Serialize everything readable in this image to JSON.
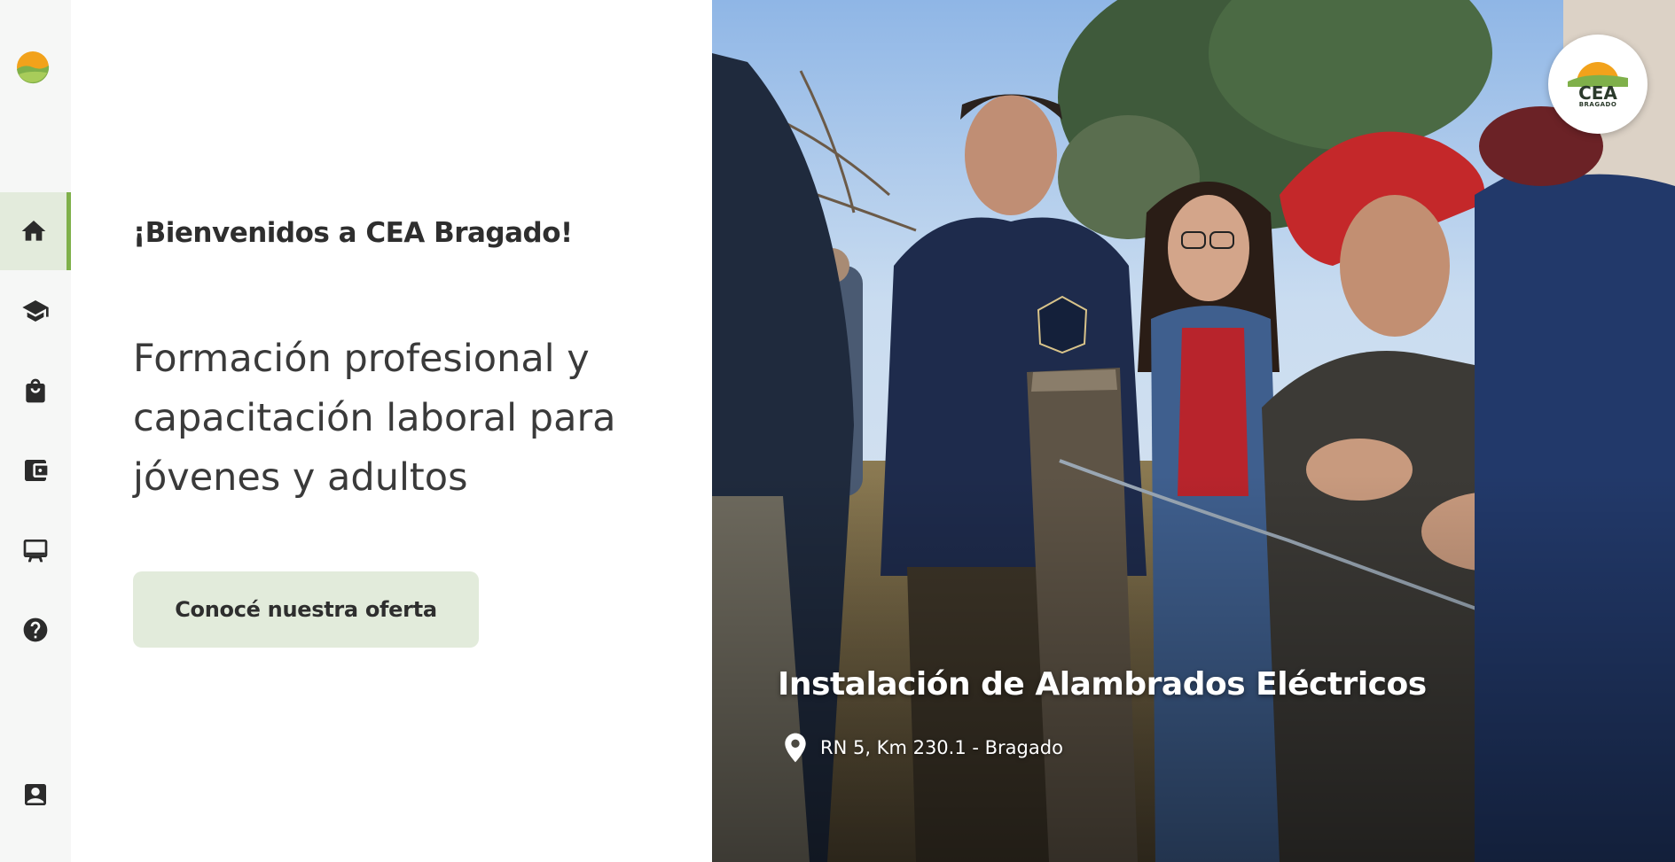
{
  "brand": {
    "badge_text": "CEA",
    "badge_subtext": "BRAGADO",
    "colors": {
      "sun": "#f2a21b",
      "field": "#7fb04a",
      "accent": "#7fb04a",
      "button_bg": "#e2ebdb"
    }
  },
  "sidebar": {
    "items": [
      {
        "icon": "home-icon",
        "active": true
      },
      {
        "icon": "graduation-cap-icon",
        "active": false
      },
      {
        "icon": "shopping-bag-icon",
        "active": false
      },
      {
        "icon": "wallet-icon",
        "active": false
      },
      {
        "icon": "presentation-board-icon",
        "active": false
      },
      {
        "icon": "help-icon",
        "active": false
      },
      {
        "icon": "contact-card-icon",
        "active": false
      }
    ]
  },
  "main": {
    "welcome": "¡Bienvenidos a CEA Bragado!",
    "headline": "Formación profesional y capacitación laboral para jóvenes y adultos",
    "cta_label": "Conocé nuestra oferta"
  },
  "hero": {
    "title": "Instalación de Alambrados Eléctricos",
    "location": "RN 5, Km 230.1 - Bragado",
    "location_icon": "map-pin-icon"
  }
}
